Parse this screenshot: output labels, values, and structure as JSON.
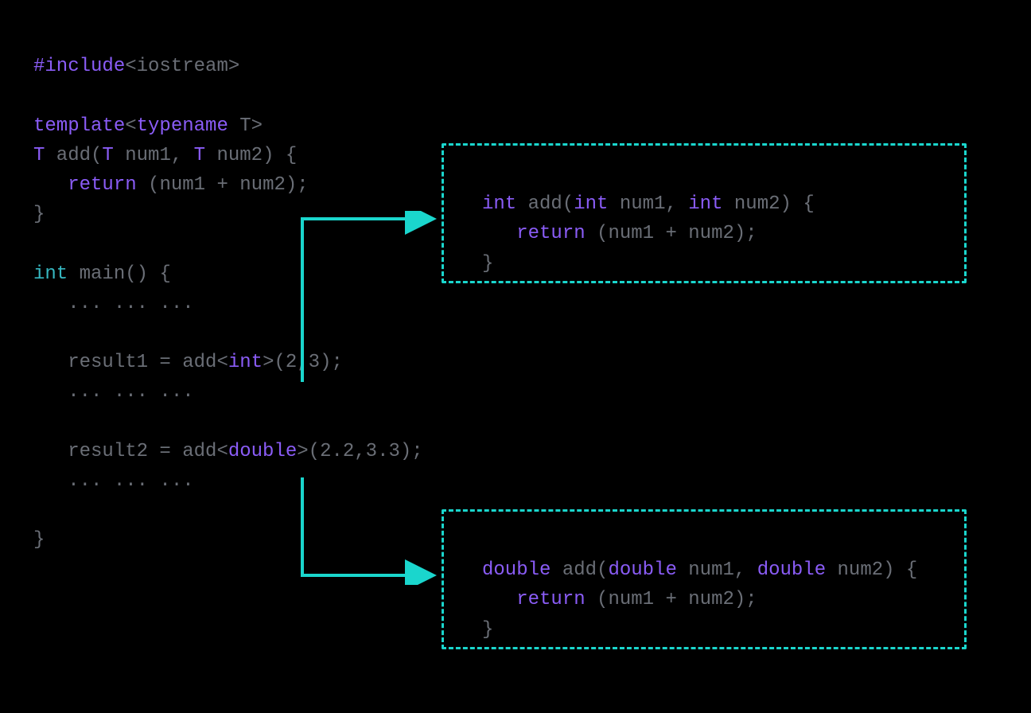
{
  "colors": {
    "keyword": "#8a5cf6",
    "type": "#36b7c0",
    "text": "#6a6e76",
    "box_border": "#1ad6cd",
    "arrow": "#1ad6cd",
    "background": "#000000"
  },
  "code_main": {
    "line1": {
      "include": "#include",
      "header": "<iostream>"
    },
    "blank1": "",
    "line2": {
      "template": "template",
      "open": "<",
      "typename": "typename",
      "T": " T",
      "close": ">"
    },
    "line3": {
      "T": "T",
      "fn": " add(",
      "T2": "T",
      "p1": " num1, ",
      "T3": "T",
      "p2": " num2) {"
    },
    "line4": {
      "indent": "   ",
      "return": "return",
      "rest": " (num1 + num2);"
    },
    "line5": {
      "brace": "}"
    },
    "blank2": "",
    "line6": {
      "int": "int",
      "main": " main() {"
    },
    "line7": {
      "dots": "   ... ... ..."
    },
    "blank3": "",
    "line8": {
      "pre": "   result1 = add<",
      "type": "int",
      "post": ">(2,3);"
    },
    "line9": {
      "dots": "   ... ... ..."
    },
    "blank4": "",
    "line10": {
      "pre": "   result2 = add<",
      "type": "double",
      "post": ">(2.2,3.3);"
    },
    "line11": {
      "dots": "   ... ... ..."
    },
    "blank5": "",
    "line12": {
      "brace": "}"
    }
  },
  "box_int": {
    "line1": {
      "ret": "int",
      "mid": " add(",
      "t1": "int",
      "p1": " num1, ",
      "t2": "int",
      "p2": " num2) {"
    },
    "line2": {
      "indent": "   ",
      "return": "return",
      "rest": " (num1 + num2);"
    },
    "line3": {
      "brace": "}"
    }
  },
  "box_double": {
    "line1": {
      "ret": "double",
      "mid": " add(",
      "t1": "double",
      "p1": " num1, ",
      "t2": "double",
      "p2": " num2) {"
    },
    "line2": {
      "indent": "   ",
      "return": "return",
      "rest": " (num1 + num2);"
    },
    "line3": {
      "brace": "}"
    }
  }
}
